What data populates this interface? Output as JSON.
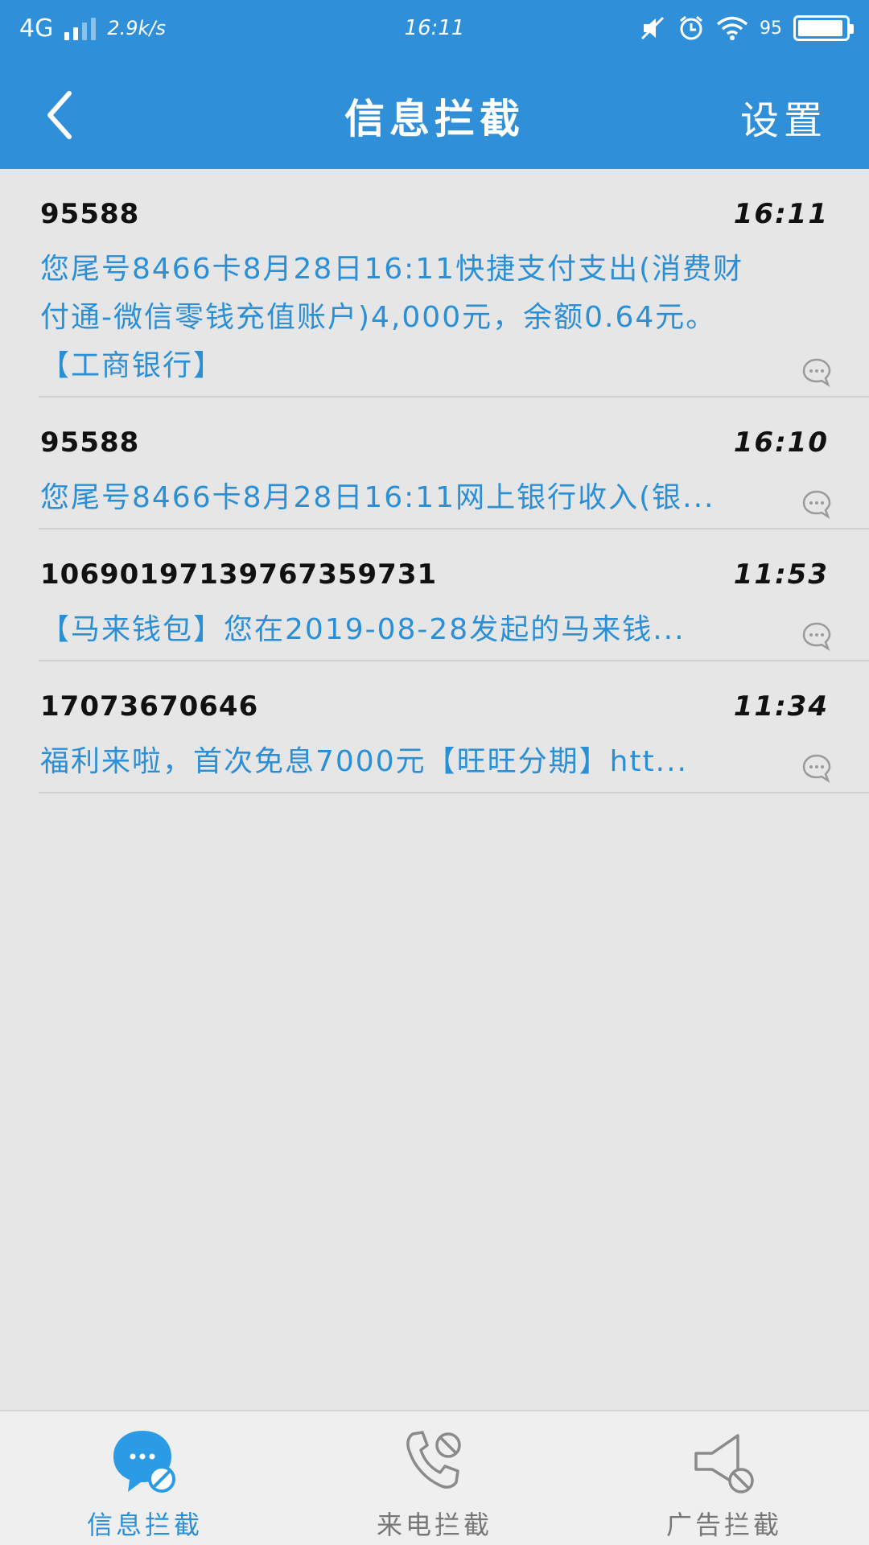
{
  "status_bar": {
    "network": "4G",
    "speed": "2.9k/s",
    "time": "16:11",
    "battery": "95"
  },
  "header": {
    "title": "信息拦截",
    "settings_label": "设置"
  },
  "messages": [
    {
      "sender": "95588",
      "time": "16:11",
      "body": "您尾号8466卡8月28日16:11快捷支付支出(消费财付通-微信零钱充值账户)4,000元，余额0.64元。【工商银行】"
    },
    {
      "sender": "95588",
      "time": "16:10",
      "body": "您尾号8466卡8月28日16:11网上银行收入(银..."
    },
    {
      "sender": "10690197139767359731",
      "time": "11:53",
      "body": "【马来钱包】您在2019-08-28发起的马来钱..."
    },
    {
      "sender": "17073670646",
      "time": "11:34",
      "body": "福利来啦，首次免息7000元【旺旺分期】htt..."
    }
  ],
  "tabs": [
    {
      "label": "信息拦截",
      "icon": "message-block-icon",
      "active": true
    },
    {
      "label": "来电拦截",
      "icon": "phone-block-icon",
      "active": false
    },
    {
      "label": "广告拦截",
      "icon": "megaphone-block-icon",
      "active": false
    }
  ],
  "colors": {
    "primary": "#2f90d9",
    "link_text": "#2b8fd6",
    "background": "#e6e6e6"
  }
}
